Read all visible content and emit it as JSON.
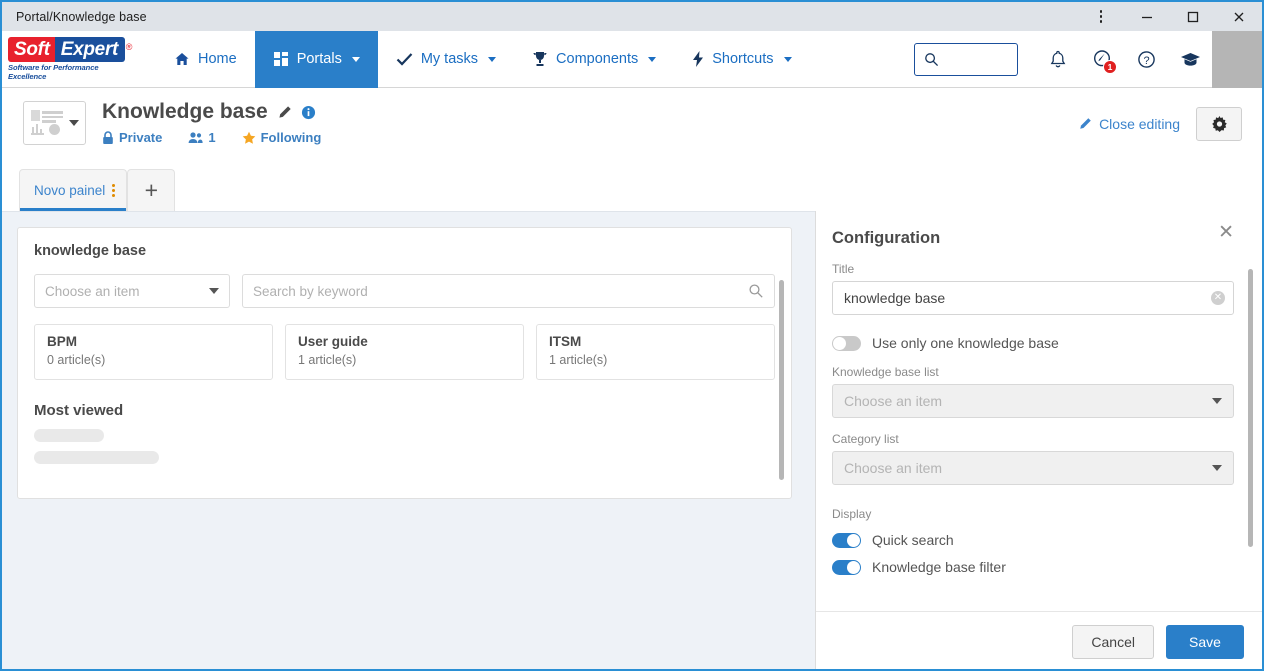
{
  "window": {
    "title": "Portal/Knowledge base",
    "controls": {
      "menu": "⋮",
      "minimize": "—",
      "maximize": "□",
      "close": "✕"
    }
  },
  "brand": {
    "name_part1": "Soft",
    "name_part2": "Expert",
    "registered": "®",
    "tagline": "Software for Performance Excellence",
    "color_red": "#e8212d",
    "color_blue": "#1a4f9c"
  },
  "nav": {
    "items": [
      {
        "label": "Home",
        "icon": "home-icon",
        "caret": false,
        "active": false
      },
      {
        "label": "Portals",
        "icon": "grid-icon",
        "caret": true,
        "active": true
      },
      {
        "label": "My tasks",
        "icon": "check-icon",
        "caret": true,
        "active": false
      },
      {
        "label": "Components",
        "icon": "trophy-icon",
        "caret": true,
        "active": false
      },
      {
        "label": "Shortcuts",
        "icon": "bolt-icon",
        "caret": true,
        "active": false
      }
    ],
    "search_placeholder": "",
    "notification_badge": "1",
    "icons": [
      "search-icon",
      "bell-icon",
      "support-icon",
      "help-icon",
      "graduation-cap-icon",
      "avatar"
    ]
  },
  "page_header": {
    "title": "Knowledge base",
    "edit_icon": "pencil-icon",
    "info_icon": "info-icon",
    "meta": [
      {
        "label": "Private",
        "icon": "lock-icon"
      },
      {
        "label": "1",
        "icon": "users-icon"
      },
      {
        "label": "Following",
        "icon": "star-icon"
      }
    ],
    "close_editing": "Close editing",
    "settings_icon": "gear-icon",
    "panel_thumb_icon": "panel-layout-icon"
  },
  "tabs": {
    "items": [
      {
        "label": "Novo painel",
        "active": true
      }
    ],
    "add_label": "+",
    "kebab_icon": "kebab-menu-icon"
  },
  "widget": {
    "title": "knowledge base",
    "kb_select_placeholder": "Choose an item",
    "search_placeholder": "Search by keyword",
    "search_icon": "search-icon",
    "cards": [
      {
        "name": "BPM",
        "count": "0 article(s)"
      },
      {
        "name": "User guide",
        "count": "1 article(s)"
      },
      {
        "name": "ITSM",
        "count": "1 article(s)"
      }
    ],
    "most_viewed_label": "Most viewed"
  },
  "config": {
    "title": "Configuration",
    "close_icon": "close-icon",
    "title_field": {
      "label": "Title",
      "value": "knowledge base",
      "clear_icon": "clear-icon"
    },
    "use_one_kb": {
      "label": "Use only one knowledge base",
      "on": false
    },
    "kb_list": {
      "label": "Knowledge base list",
      "placeholder": "Choose an item",
      "disabled": true
    },
    "category_list": {
      "label": "Category list",
      "placeholder": "Choose an item",
      "disabled": true
    },
    "display_label": "Display",
    "display_toggles": [
      {
        "label": "Quick search",
        "on": true
      },
      {
        "label": "Knowledge base filter",
        "on": true
      }
    ],
    "cancel_label": "Cancel",
    "save_label": "Save",
    "accent_color": "#2a7fc9"
  }
}
